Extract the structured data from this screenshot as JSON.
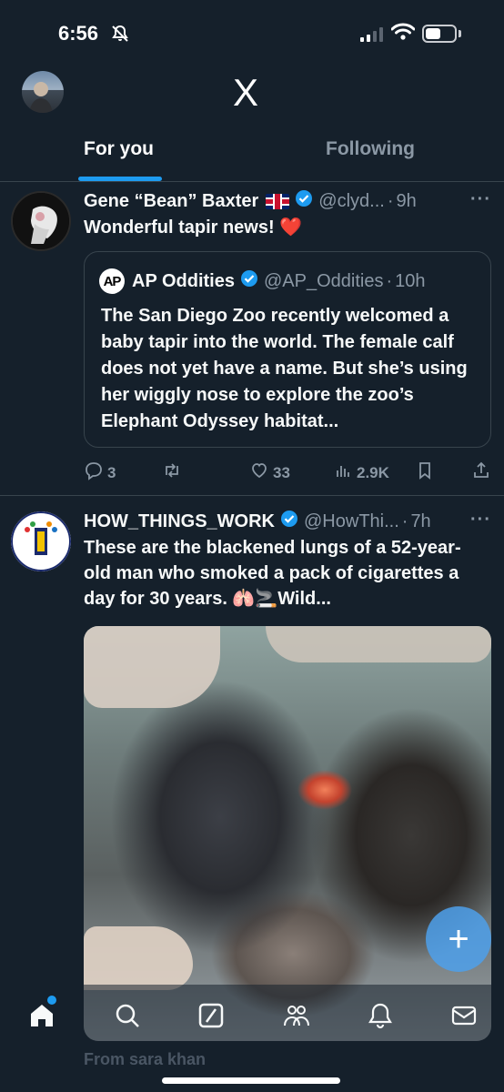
{
  "status_bar": {
    "time": "6:56"
  },
  "header": {
    "logo": "X"
  },
  "tabs": [
    {
      "label": "For you",
      "active": true
    },
    {
      "label": "Following",
      "active": false
    }
  ],
  "tweets": [
    {
      "name": "Gene “Bean” Baxter",
      "handle": "@clyd...",
      "time": "9h",
      "text": "Wonderful tapir news! ❤️",
      "quote": {
        "name": "AP Oddities",
        "logo_text": "AP",
        "handle": "@AP_Oddities",
        "time": "10h",
        "text": "The San Diego Zoo recently welcomed a baby tapir into the world. The female calf does not yet have a name. But she’s using her wiggly nose to explore the zoo’s Elephant Odyssey habitat..."
      },
      "actions": {
        "replies": "3",
        "reposts": "",
        "likes": "33",
        "views": "2.9K"
      }
    },
    {
      "name": "HOW_THINGS_WORK",
      "handle": "@HowThi...",
      "time": "7h",
      "text": "These are the blackened lungs of a 52-year-old man who smoked a pack of cigarettes a day for 30 years. 🫁🚬Wild...",
      "avatar_text": "How things work"
    }
  ],
  "next_item": {
    "from_label": "From sara khan"
  },
  "colors": {
    "background": "#15202b",
    "accent": "#1d9bf0",
    "muted": "#8b98a5",
    "divider": "#38444d"
  },
  "icons": [
    "bell-slash-icon",
    "signal-icon",
    "wifi-icon",
    "battery-icon",
    "verified-icon",
    "more-icon",
    "reply-icon",
    "repost-icon",
    "like-icon",
    "views-icon",
    "bookmark-icon",
    "share-icon",
    "compose-icon",
    "home-icon",
    "search-icon",
    "grok-icon",
    "communities-icon",
    "notifications-icon",
    "messages-icon"
  ]
}
